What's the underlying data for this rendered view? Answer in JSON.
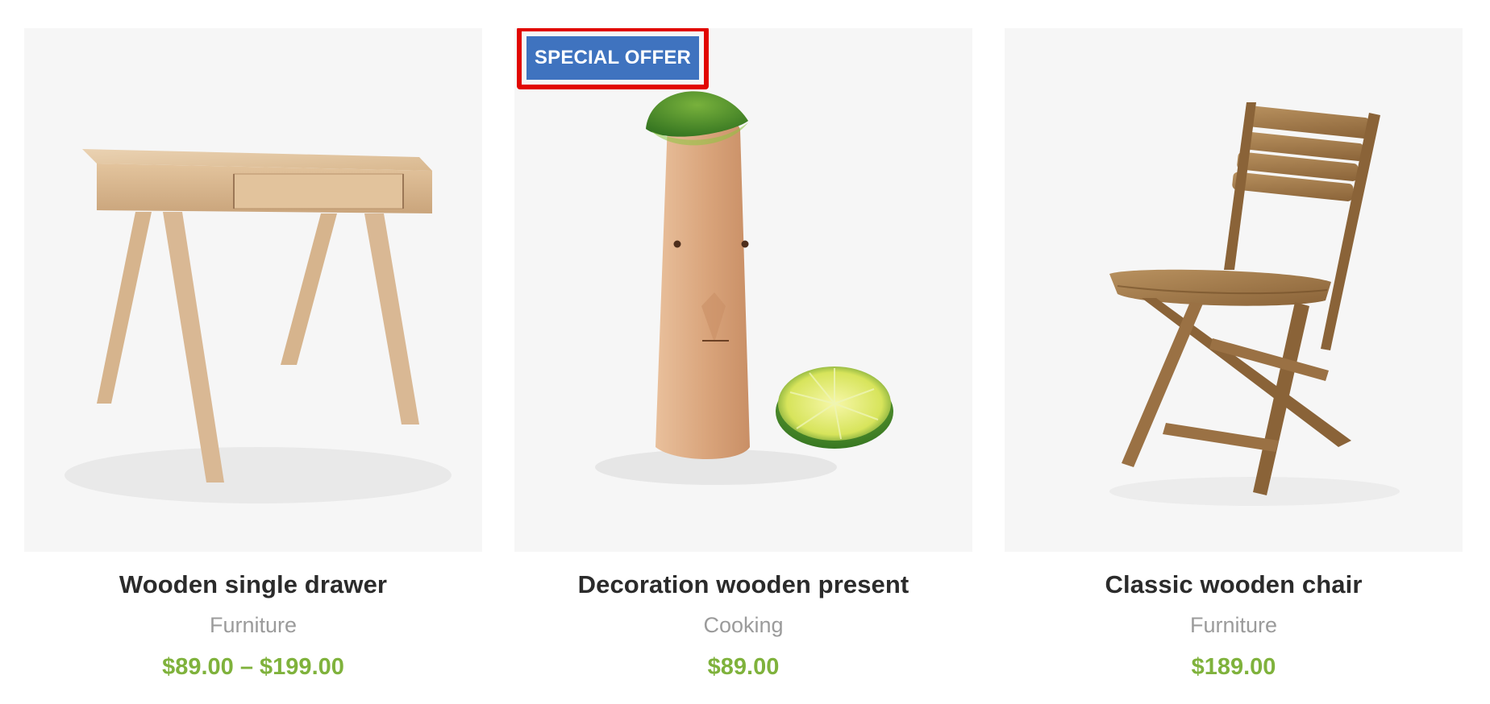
{
  "products": [
    {
      "title": "Wooden single drawer",
      "category": "Furniture",
      "price": "$89.00 – $199.00",
      "image_icon": "wooden-desk-image"
    },
    {
      "title": "Decoration wooden present",
      "category": "Cooking",
      "price": "$89.00",
      "badge": "SPECIAL OFFER",
      "image_icon": "wooden-figure-with-lime-image"
    },
    {
      "title": "Classic wooden chair",
      "category": "Furniture",
      "price": "$189.00",
      "image_icon": "wooden-folding-chair-image"
    }
  ],
  "colors": {
    "price": "#7fb23c",
    "badge_bg": "#3f73bf",
    "badge_highlight": "#e10600",
    "title": "#2b2b2b",
    "category": "#9b9b9b",
    "image_bg": "#f6f6f6"
  }
}
